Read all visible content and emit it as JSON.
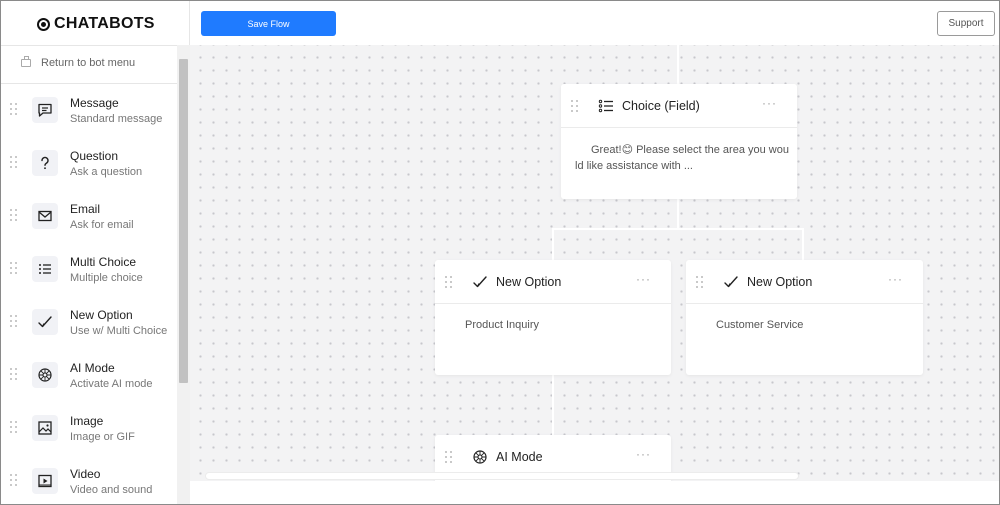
{
  "brand": {
    "name": "CHATABOTS"
  },
  "toolbar": {
    "save_label": "Save Flow",
    "support_label": "Support"
  },
  "sidebar": {
    "back_label": "Return to bot menu",
    "items": [
      {
        "title": "Message",
        "subtitle": "Standard message",
        "icon": "message-icon"
      },
      {
        "title": "Question",
        "subtitle": "Ask a question",
        "icon": "question-icon"
      },
      {
        "title": "Email",
        "subtitle": "Ask for email",
        "icon": "email-icon"
      },
      {
        "title": "Multi Choice",
        "subtitle": "Multiple choice",
        "icon": "list-icon"
      },
      {
        "title": "New Option",
        "subtitle": "Use w/ Multi Choice",
        "icon": "checkmark-icon"
      },
      {
        "title": "AI Mode",
        "subtitle": "Activate AI mode",
        "icon": "ai-icon"
      },
      {
        "title": "Image",
        "subtitle": "Image or GIF",
        "icon": "image-icon"
      },
      {
        "title": "Video",
        "subtitle": "Video and sound",
        "icon": "video-icon"
      }
    ]
  },
  "flow": {
    "choice_node": {
      "title": "Choice (Field)",
      "body_line1": "Great!😊  Please select the area you wou",
      "body_line2": "ld like assistance with ..."
    },
    "option_left": {
      "title": "New Option",
      "body": "Product Inquiry"
    },
    "option_right": {
      "title": "New Option",
      "body": "Customer Service"
    },
    "ai_node": {
      "title": "AI Mode"
    },
    "more_label": "···"
  },
  "colors": {
    "accent": "#1f7bff",
    "canvas": "#f3f3f4",
    "dot": "#c7c7cc"
  }
}
